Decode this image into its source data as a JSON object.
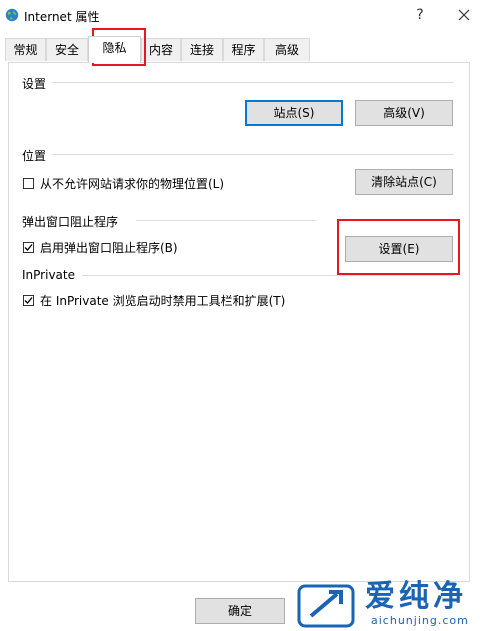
{
  "window": {
    "title": "Internet 属性",
    "help_label": "?"
  },
  "tabs": [
    {
      "label": "常规"
    },
    {
      "label": "安全"
    },
    {
      "label": "隐私",
      "active": true
    },
    {
      "label": "内容"
    },
    {
      "label": "连接"
    },
    {
      "label": "程序"
    },
    {
      "label": "高级"
    }
  ],
  "settings_section": {
    "label": "设置",
    "sites_button": "站点(S)",
    "advanced_button": "高级(V)"
  },
  "location_section": {
    "label": "位置",
    "checkbox_label": "从不允许网站请求你的物理位置(L)",
    "checkbox_checked": false,
    "clear_sites_button": "清除站点(C)"
  },
  "popup_section": {
    "label": "弹出窗口阻止程序",
    "checkbox_label": "启用弹出窗口阻止程序(B)",
    "checkbox_checked": true,
    "settings_button": "设置(E)"
  },
  "inprivate_section": {
    "label": "InPrivate",
    "checkbox_label": "在 InPrivate 浏览启动时禁用工具栏和扩展(T)",
    "checkbox_checked": true
  },
  "footer": {
    "ok_button": "确定"
  },
  "watermark": {
    "text_cn": "爱纯净",
    "url": "aichunjing.com"
  },
  "colors": {
    "highlight": "#e8161e",
    "focus_border": "#0078d7",
    "button_bg": "#e1e1e1",
    "watermark_blue": "#1a64b4"
  }
}
